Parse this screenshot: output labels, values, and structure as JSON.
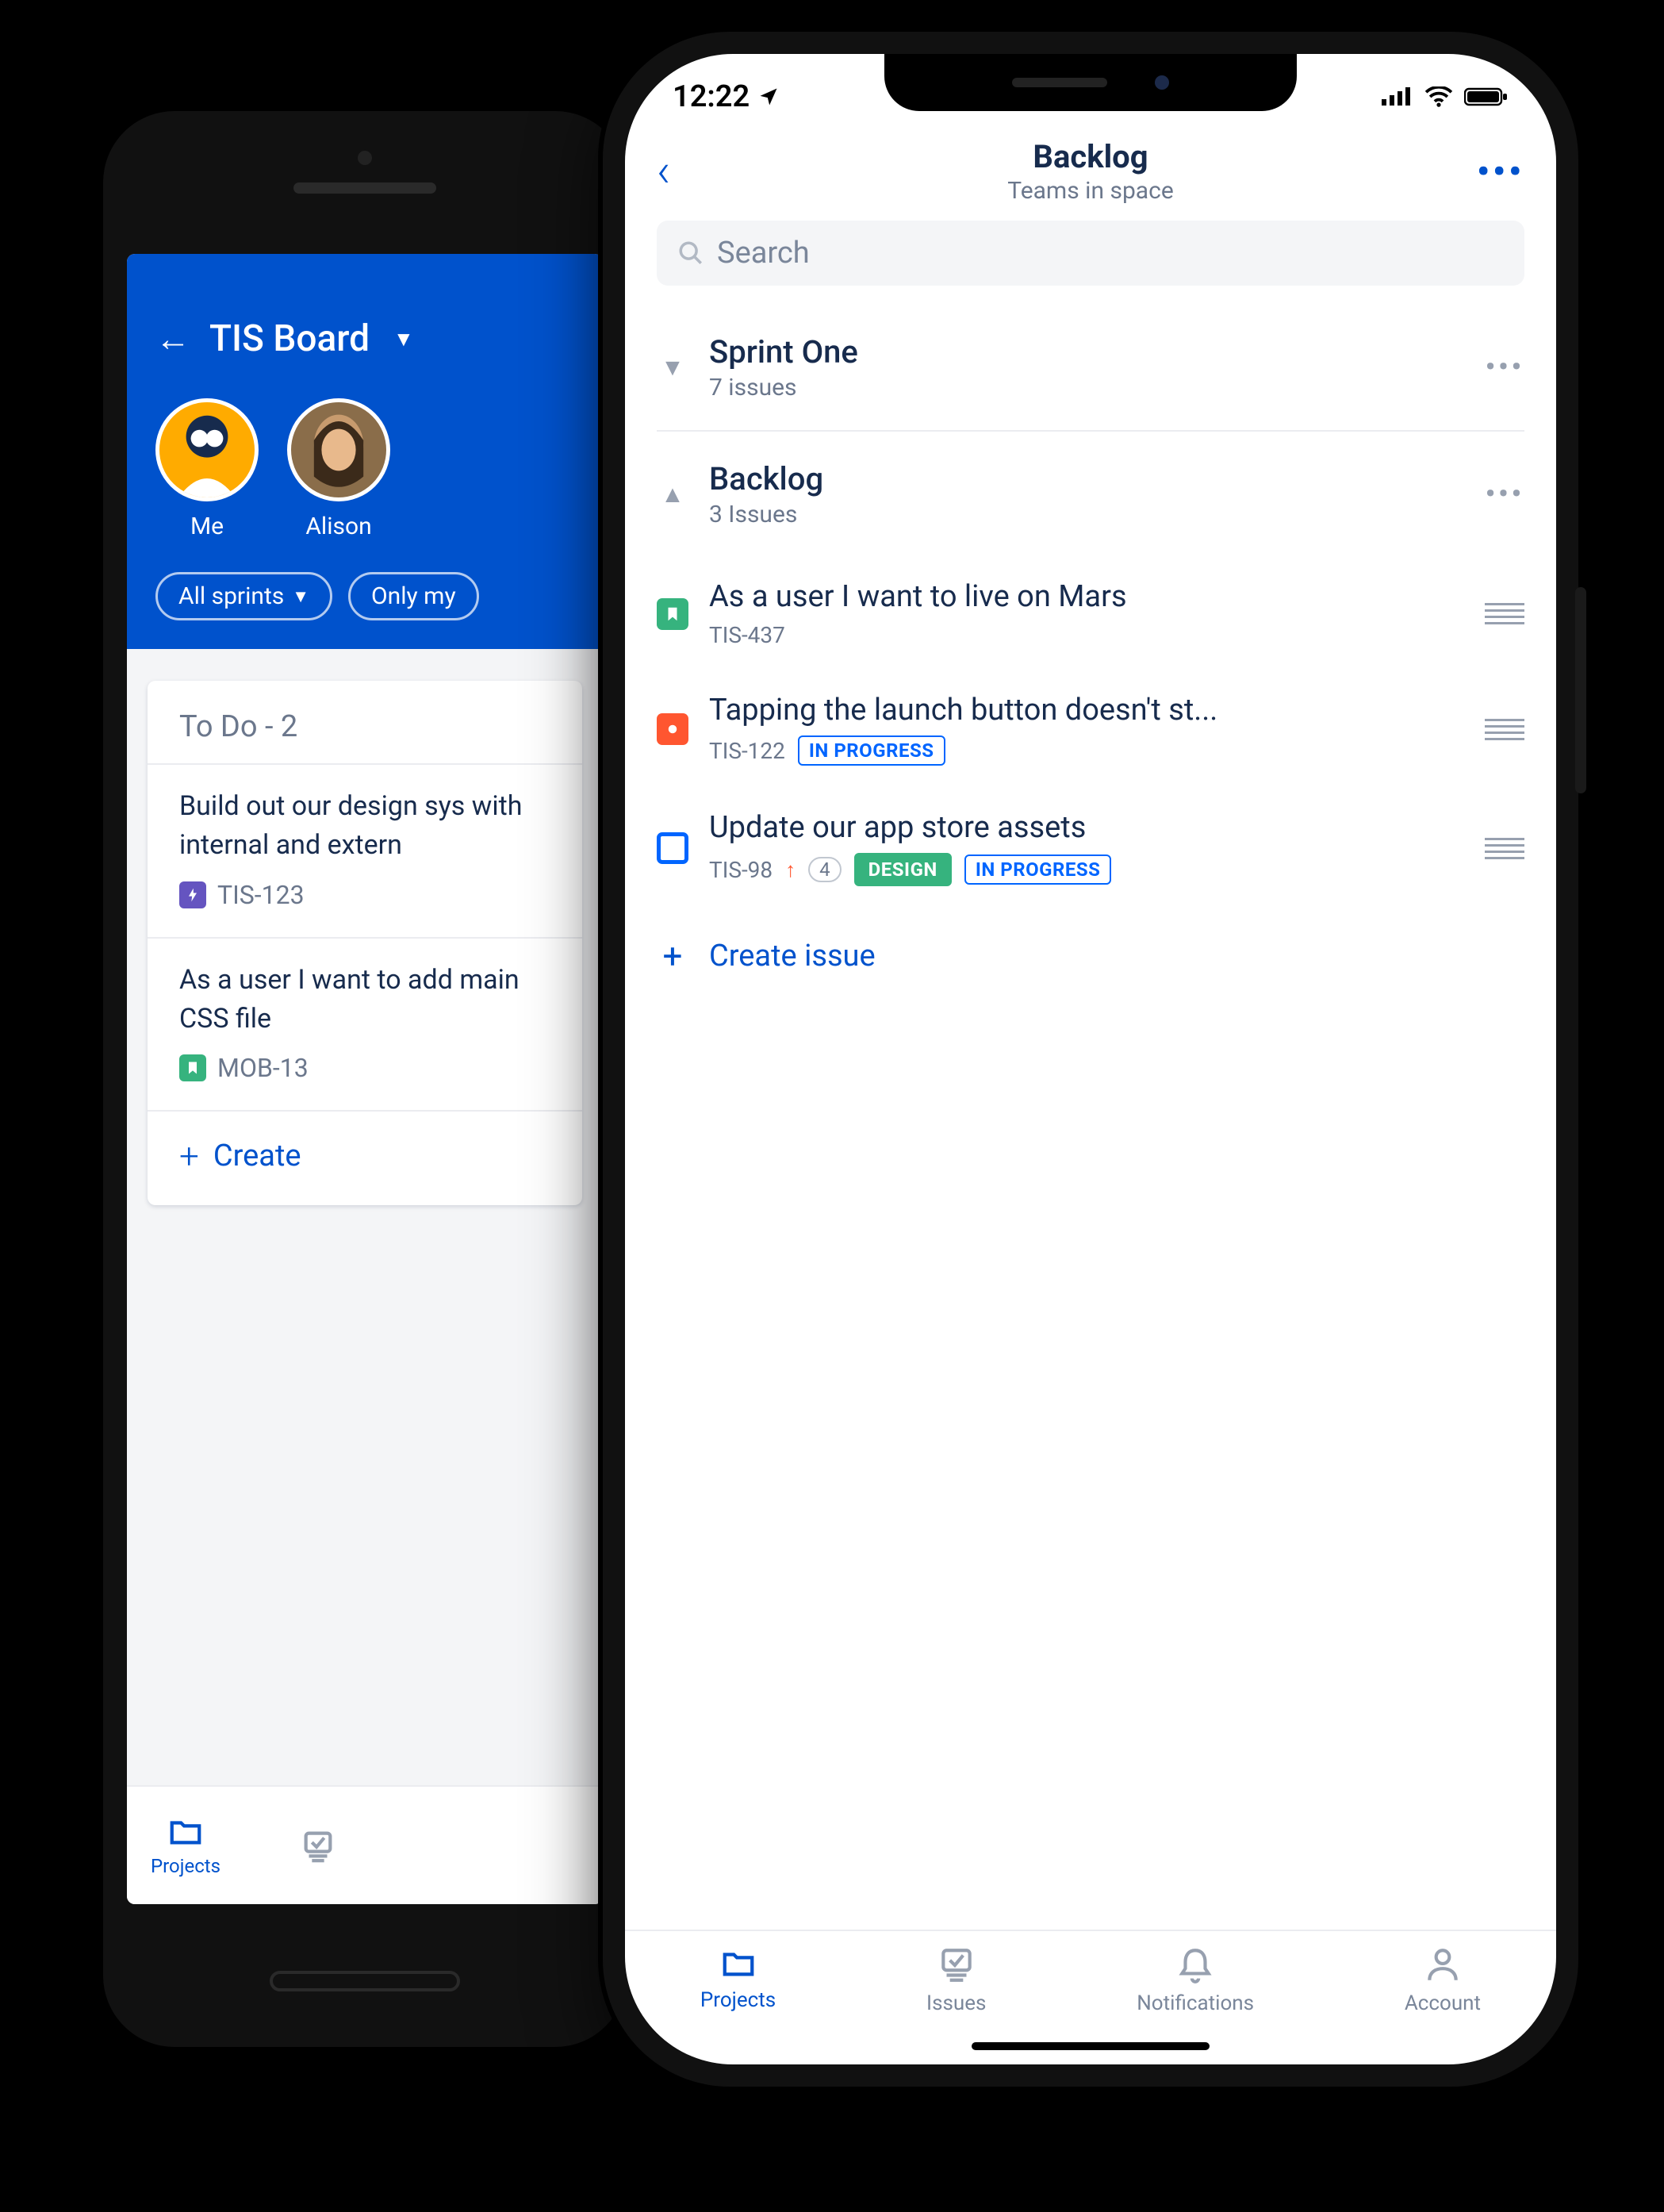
{
  "android": {
    "header": {
      "title": "TIS Board",
      "avatars": [
        {
          "name": "Me"
        },
        {
          "name": "Alison"
        }
      ],
      "filters": [
        {
          "label": "All sprints"
        },
        {
          "label": "Only my"
        }
      ]
    },
    "column": {
      "title": "To Do - 2",
      "cards": [
        {
          "text": "Build out our design sys with internal and extern",
          "key": "TIS-123",
          "type": "epic"
        },
        {
          "text": "As a user I want to add main CSS file",
          "key": "MOB-13",
          "type": "story"
        }
      ],
      "create_label": "Create"
    },
    "tabs": {
      "projects": "Projects"
    }
  },
  "iphone": {
    "status": {
      "time": "12:22"
    },
    "nav": {
      "title": "Backlog",
      "subtitle": "Teams in space"
    },
    "search": {
      "placeholder": "Search"
    },
    "sections": [
      {
        "id": "sprint",
        "title": "Sprint One",
        "sub": "7 issues",
        "expanded": false
      },
      {
        "id": "backlog",
        "title": "Backlog",
        "sub": "3 Issues",
        "expanded": true
      }
    ],
    "issues": [
      {
        "type": "story",
        "title": "As a user I want to live on Mars",
        "key": "TIS-437",
        "badges": []
      },
      {
        "type": "bug",
        "title": "Tapping the launch button doesn't st...",
        "key": "TIS-122",
        "badges": [
          {
            "kind": "status",
            "text": "IN PROGRESS"
          }
        ]
      },
      {
        "type": "task",
        "title": "Update our app store assets",
        "key": "TIS-98",
        "priority_up": true,
        "story_points": "4",
        "badges": [
          {
            "kind": "design",
            "text": "DESIGN"
          },
          {
            "kind": "status",
            "text": "IN PROGRESS"
          }
        ]
      }
    ],
    "create_label": "Create issue",
    "tabs": [
      {
        "id": "projects",
        "label": "Projects",
        "active": true
      },
      {
        "id": "issues",
        "label": "Issues",
        "active": false
      },
      {
        "id": "notifications",
        "label": "Notifications",
        "active": false
      },
      {
        "id": "account",
        "label": "Account",
        "active": false
      }
    ]
  }
}
